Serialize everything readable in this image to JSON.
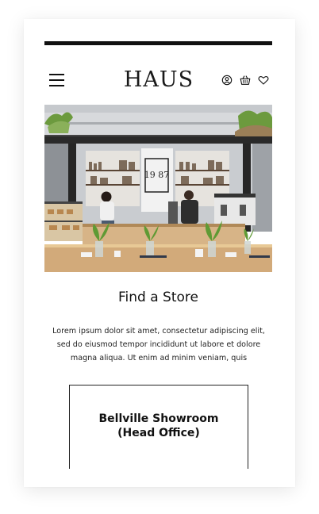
{
  "brand": {
    "logo_text": "HAUS"
  },
  "header_icons": [
    "menu-icon",
    "user-icon",
    "basket-icon",
    "heart-icon"
  ],
  "hero": {
    "sign_text": "19 87"
  },
  "section": {
    "title": "Find a Store",
    "body": "Lorem ipsum dolor sit amet, consectetur adipiscing elit, sed do eiusmod tempor incididunt ut labore et dolore magna aliqua. Ut enim ad minim veniam, quis"
  },
  "stores": [
    {
      "name_line1": "Bellville Showroom",
      "name_line2": "(Head Office)"
    }
  ],
  "colors": {
    "text": "#111111",
    "card_border": "#222222",
    "background": "#ffffff"
  }
}
